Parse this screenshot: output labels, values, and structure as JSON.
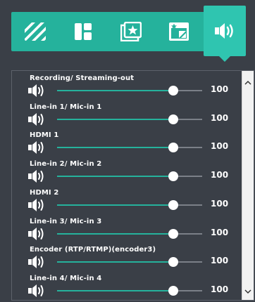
{
  "tabs": [
    {
      "icon": "diagonal-stripes-icon",
      "active": false
    },
    {
      "icon": "layout-grid-icon",
      "active": false
    },
    {
      "icon": "star-overlay-icon",
      "active": false
    },
    {
      "icon": "star-window-icon",
      "active": false
    },
    {
      "icon": "speaker-icon",
      "active": true
    }
  ],
  "channels": [
    {
      "label": "Recording/ Streaming-out",
      "value": "100",
      "level": 0.8
    },
    {
      "label": "Line-in 1/ Mic-in 1",
      "value": "100",
      "level": 0.8
    },
    {
      "label": "HDMI 1",
      "value": "100",
      "level": 0.8
    },
    {
      "label": "Line-in 2/ Mic-in 2",
      "value": "100",
      "level": 0.8
    },
    {
      "label": "HDMI 2",
      "value": "100",
      "level": 0.8
    },
    {
      "label": "Line-in 3/ Mic-in 3",
      "value": "100",
      "level": 0.8
    },
    {
      "label": "Encoder (RTP/RTMP)(encoder3)",
      "value": "100",
      "level": 0.8
    },
    {
      "label": "Line-in 4/ Mic-in 4",
      "value": "100",
      "level": 0.8
    }
  ],
  "colors": {
    "accent": "#25b29c",
    "accent_active": "#2fc5b0",
    "background": "#3a3f47",
    "track": "#7b8088"
  }
}
